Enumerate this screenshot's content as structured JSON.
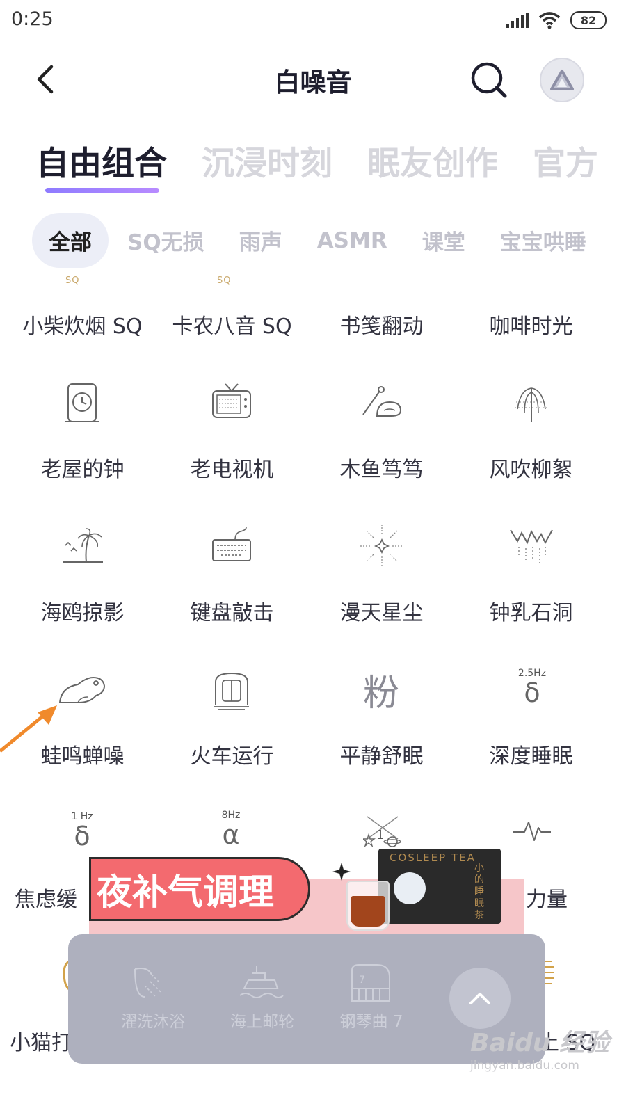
{
  "status_bar": {
    "time": "0:25",
    "battery": "82"
  },
  "header": {
    "title": "白噪音"
  },
  "tabs": [
    {
      "label": "自由组合"
    },
    {
      "label": "沉浸时刻"
    },
    {
      "label": "眠友创作"
    },
    {
      "label": "官方"
    }
  ],
  "chips": [
    {
      "label": "全部"
    },
    {
      "label": "SQ无损"
    },
    {
      "label": "雨声"
    },
    {
      "label": "ASMR"
    },
    {
      "label": "课堂"
    },
    {
      "label": "宝宝哄睡"
    }
  ],
  "sounds": {
    "row0": [
      "小柴炊烟 SQ",
      "卡农八音 SQ",
      "书笺翻动",
      "咖啡时光"
    ],
    "row0_badges": [
      "SQ",
      "SQ"
    ],
    "row1": [
      "老屋的钟",
      "老电视机",
      "木鱼笃笃",
      "风吹柳絮"
    ],
    "row2": [
      "海鸥掠影",
      "键盘敲击",
      "漫天星尘",
      "钟乳石洞"
    ],
    "row3": [
      "蛙鸣蝉噪",
      "火车运行",
      "平静舒眠",
      "深度睡眠"
    ],
    "row3_icon_text": {
      "calm": "粉",
      "deep_hz": "2.5Hz",
      "deep_sym": "δ"
    },
    "row4": [
      "焦虑缓",
      "",
      "",
      "力量"
    ],
    "row4_icon_text": {
      "a_hz": "1 Hz",
      "a_sym": "δ",
      "b_hz": "8Hz",
      "b_sym": "α",
      "c_num": "1"
    },
    "row5": [
      "小猫打",
      "",
      "",
      "土 SQ"
    ]
  },
  "ad": {
    "slogan": "夜补气调理",
    "brand": "COSLEEP TEA",
    "brand_cn": "小的睡眠茶"
  },
  "mini_player": {
    "items": [
      {
        "label": "濯洗沐浴",
        "icon": "shower-icon"
      },
      {
        "label": "海上邮轮",
        "icon": "ship-icon"
      },
      {
        "label": "钢琴曲 7",
        "icon": "piano-icon",
        "badge": "7"
      }
    ]
  },
  "watermark": {
    "brand": "Baidu 经验",
    "url": "jingyan.baidu.com"
  },
  "colors": {
    "accent": "#9a82ff",
    "ad_red": "#f36a6f",
    "player_bg": "#aeb0be",
    "pointer_arrow": "#f08a2c"
  }
}
